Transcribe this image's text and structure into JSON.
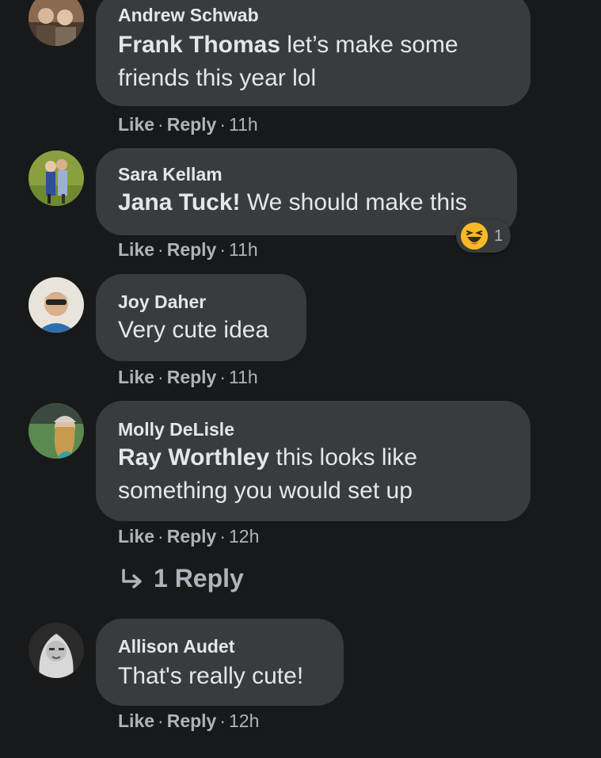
{
  "comments": [
    {
      "author": "Andrew Schwab",
      "mention": "Frank Thomas",
      "text_line1": " let’s make some",
      "text_line2": "friends this year lol",
      "like": "Like",
      "reply": "Reply",
      "time": "11h"
    },
    {
      "author": "Sara Kellam",
      "mention": "Jana Tuck!",
      "text_line1": " We should make this",
      "like": "Like",
      "reply": "Reply",
      "time": "11h",
      "reaction": {
        "emoji": "laughing-face-icon",
        "count": "1"
      }
    },
    {
      "author": "Joy Daher",
      "text_line1": "Very cute idea",
      "like": "Like",
      "reply": "Reply",
      "time": "11h"
    },
    {
      "author": "Molly DeLisle",
      "mention": "Ray Worthley",
      "text_line1": " this looks like",
      "text_line2": "something you would set up",
      "like": "Like",
      "reply": "Reply",
      "time": "12h",
      "replies_link": "1 Reply"
    },
    {
      "author": "Allison Audet",
      "text_line1": "That's really cute!",
      "like": "Like",
      "reply": "Reply",
      "time": "12h"
    }
  ],
  "separator": "·",
  "colors": {
    "background": "#18191a",
    "bubble": "#3a3b3c",
    "primary_text": "#e4e6eb",
    "secondary_text": "#b0b3b8",
    "reaction_yellow": "#f7b928"
  }
}
